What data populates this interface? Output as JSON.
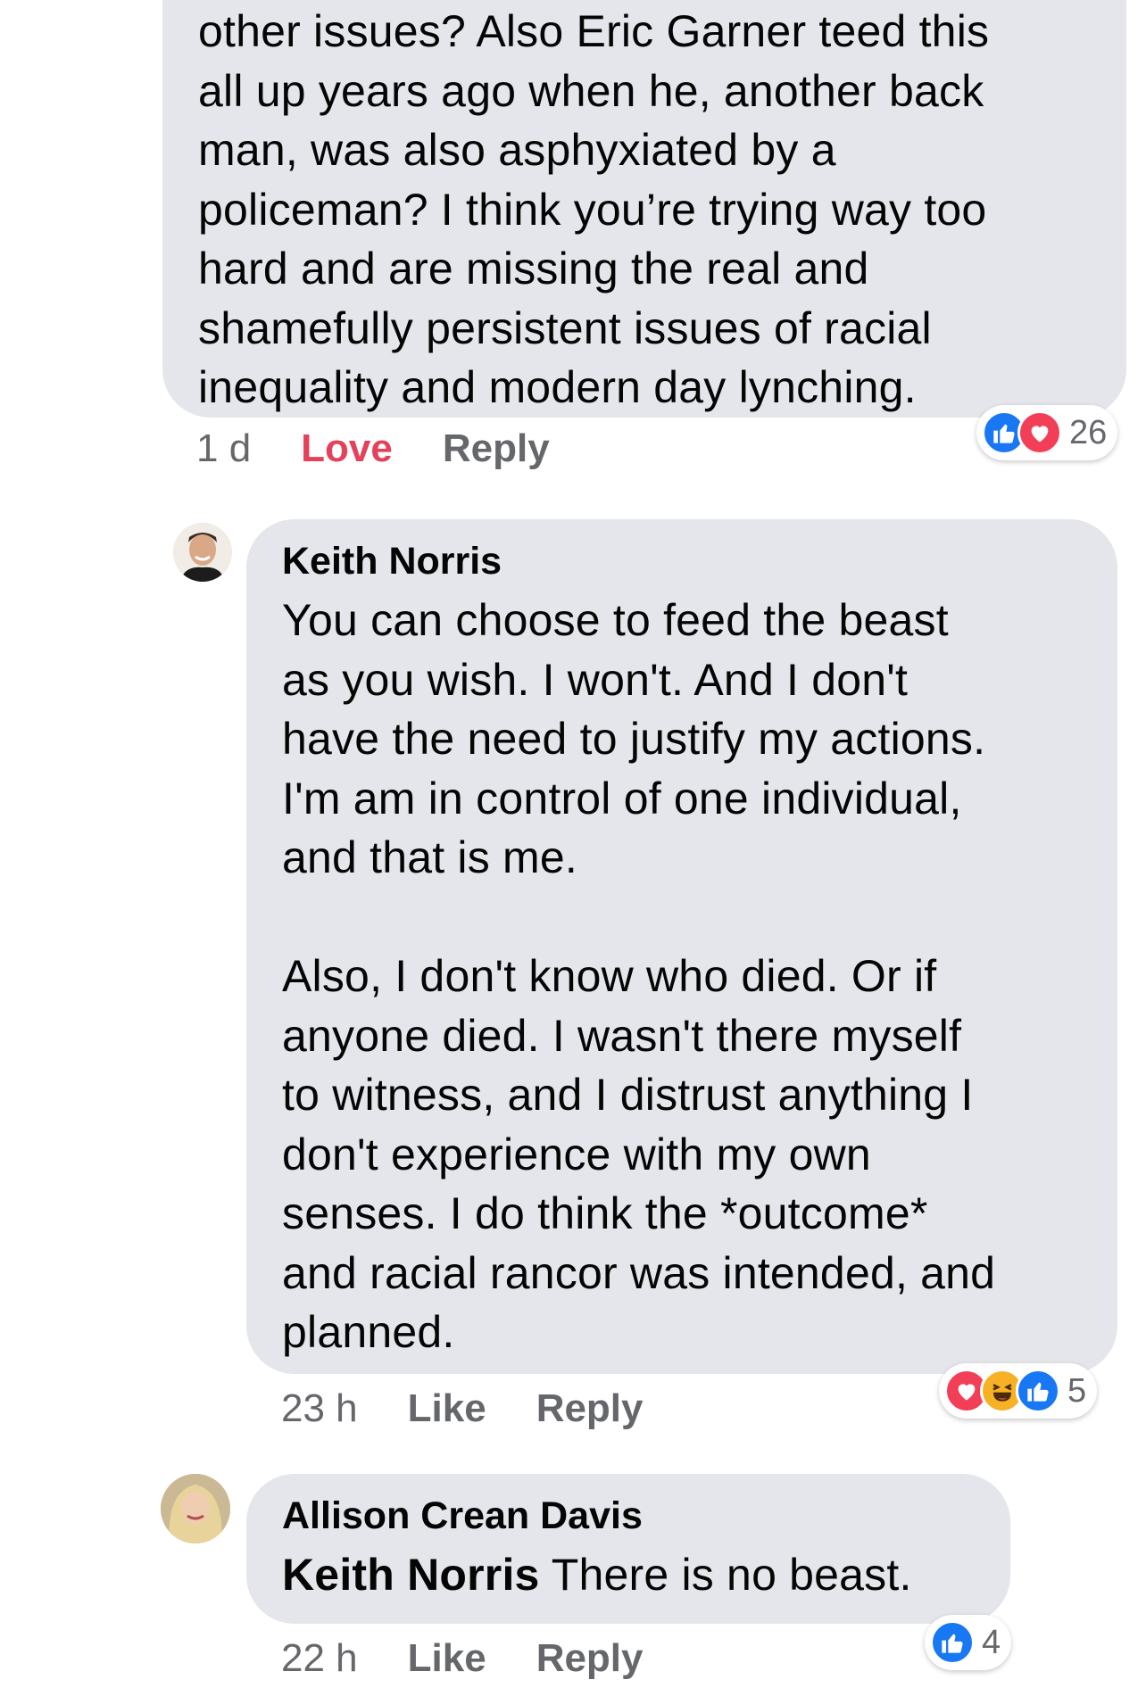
{
  "colors": {
    "bubble": "#e4e6eb",
    "meta_text": "#65676b",
    "love_accent": "#e4415b",
    "like_blue": "#1877f2",
    "heart_red": "#f33e58",
    "haha_yellow": "#f7b125"
  },
  "comments": [
    {
      "text": "other issues? Also Eric Garner teed this\nall up years ago when he, another back\nman, was also asphyxiated by a\npoliceman? I think you’re trying way too\nhard and are missing the real and\nshamefully persistent issues of racial\ninequality and modern day lynching.",
      "time": "1 d",
      "reaction_action": "Love",
      "reply_label": "Reply",
      "reactions": {
        "icons": [
          "like-icon",
          "love-icon"
        ],
        "count": "26"
      }
    },
    {
      "author": "Keith Norris",
      "text": "You can choose to feed the beast\nas you wish.  I won't.  And I don't\nhave the need to justify my actions.\nI'm am in control of one individual,\nand that is me.\n\nAlso, I don't know who died. Or if\nanyone died.  I wasn't there myself\nto witness, and I distrust anything I\ndon't experience with my own\nsenses.  I do think the *outcome*\nand racial rancor was intended, and\nplanned.",
      "time": "23 h",
      "reaction_action": "Like",
      "reply_label": "Reply",
      "reactions": {
        "icons": [
          "love-icon",
          "haha-icon",
          "like-icon"
        ],
        "count": "5"
      }
    },
    {
      "author": "Allison Crean Davis",
      "mention": "Keith Norris",
      "text": " There is no beast.",
      "time": "22 h",
      "reaction_action": "Like",
      "reply_label": "Reply",
      "reactions": {
        "icons": [
          "like-icon"
        ],
        "count": "4"
      }
    }
  ]
}
